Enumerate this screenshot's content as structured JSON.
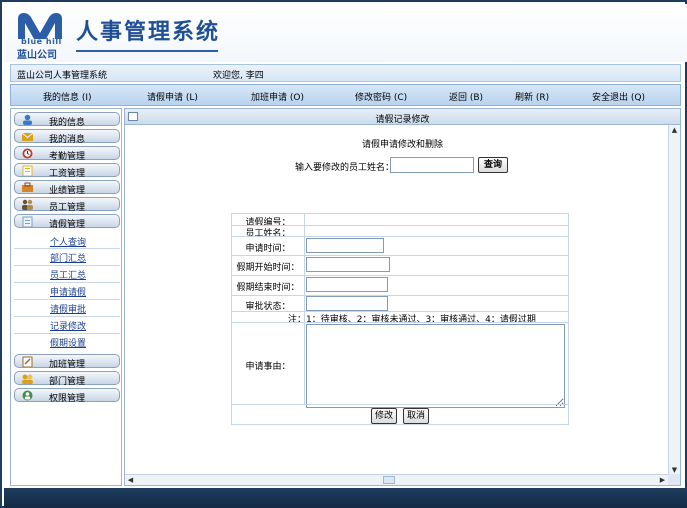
{
  "header": {
    "logo_en": "blue hill",
    "logo_cn": "蓝山公司",
    "system_title": "人事管理系统"
  },
  "info_bar": {
    "system_name": "蓝山公司人事管理系统",
    "welcome": "欢迎您, 李四"
  },
  "nav": [
    {
      "label": "我的信息 (I)"
    },
    {
      "label": "请假申请 (L)"
    },
    {
      "label": "加班申请 (O)"
    },
    {
      "label": "修改密码 (C)"
    },
    {
      "label": "返回 (B)"
    },
    {
      "label": "刷新 (R)"
    },
    {
      "label": "安全退出 (Q)"
    }
  ],
  "sidebar": {
    "menus_top": [
      {
        "label": "我的信息",
        "icon": "user-icon",
        "color": "#3a7cc2"
      },
      {
        "label": "我的消息",
        "icon": "message-icon",
        "color": "#d9a21b"
      },
      {
        "label": "考勤管理",
        "icon": "clock-icon",
        "color": "#c0392b"
      },
      {
        "label": "工资管理",
        "icon": "wage-icon",
        "color": "#e6b422"
      },
      {
        "label": "业绩管理",
        "icon": "performance-icon",
        "color": "#d98324"
      },
      {
        "label": "员工管理",
        "icon": "staff-icon",
        "color": "#6b4e2e"
      },
      {
        "label": "请假管理",
        "icon": "leave-icon",
        "color": "#7a9ec4"
      }
    ],
    "sub_items": [
      {
        "label": "个人查询"
      },
      {
        "label": "部门汇总"
      },
      {
        "label": "员工汇总"
      },
      {
        "label": "申请请假"
      },
      {
        "label": "请假审批"
      },
      {
        "label": "记录修改"
      },
      {
        "label": "假期设置"
      }
    ],
    "menus_bottom": [
      {
        "label": "加班管理",
        "icon": "overtime-icon",
        "color": "#9b6a2f"
      },
      {
        "label": "部门管理",
        "icon": "department-icon",
        "color": "#d9a21b"
      },
      {
        "label": "权限管理",
        "icon": "permission-icon",
        "color": "#3f8f4a"
      }
    ]
  },
  "content": {
    "panel_title": "请假记录修改",
    "page_title": "请假申请修改和删除",
    "search_label": "输入要修改的员工姓名：",
    "search_value": "",
    "search_button": "查询",
    "form": {
      "leave_id_label": "请假编号：",
      "employee_name_label": "员工姓名：",
      "apply_time_label": "申请时间：",
      "start_time_label": "假期开始时间：",
      "end_time_label": "假期结束时间：",
      "status_label": "审批状态：",
      "status_note": "注：1：待审核、2：审核未通过、3：审核通过、4：请假过期",
      "reason_label": "申请事由：",
      "modify_button": "修改",
      "cancel_button": "取消"
    }
  },
  "colors": {
    "brand_blue": "#1f4f96",
    "frame_dark": "#1d3c5e",
    "nav_bg": "#c8ddf2"
  }
}
